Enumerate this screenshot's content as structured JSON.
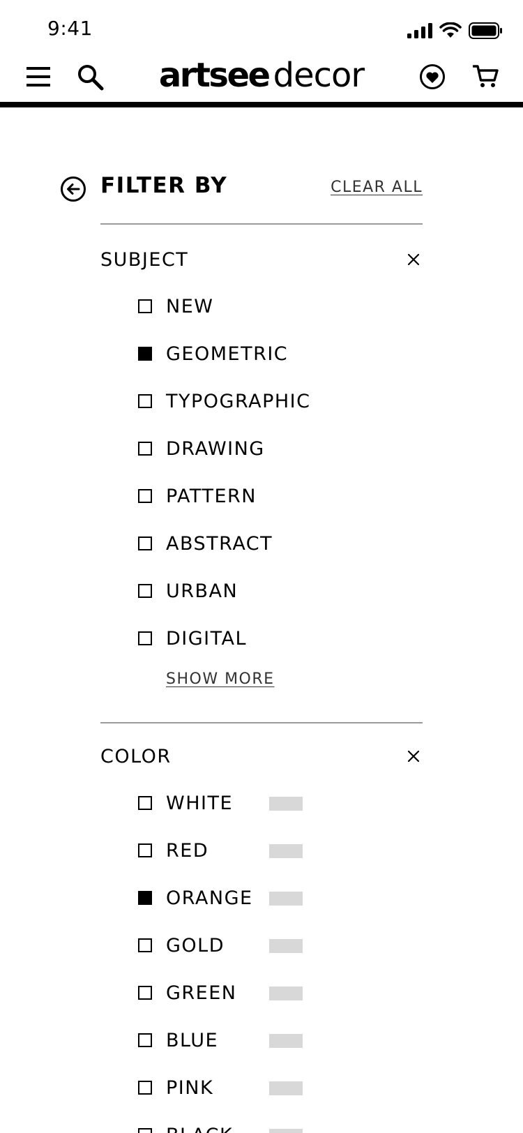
{
  "status_bar": {
    "time": "9:41"
  },
  "header": {
    "logo_bold": "artsee",
    "logo_light": "decor",
    "icons": [
      "menu-icon",
      "search-icon",
      "favorites-heart-icon",
      "cart-icon"
    ]
  },
  "filter": {
    "title": "FILTER BY",
    "clear_all": "CLEAR ALL"
  },
  "subject": {
    "title": "SUBJECT",
    "options": [
      {
        "label": "NEW",
        "checked": false
      },
      {
        "label": "GEOMETRIC",
        "checked": true
      },
      {
        "label": "TYPOGRAPHIC",
        "checked": false
      },
      {
        "label": "DRAWING",
        "checked": false
      },
      {
        "label": "PATTERN",
        "checked": false
      },
      {
        "label": "ABSTRACT",
        "checked": false
      },
      {
        "label": "URBAN",
        "checked": false
      },
      {
        "label": "DIGITAL",
        "checked": false
      }
    ],
    "show_more": "SHOW MORE"
  },
  "color": {
    "title": "COLOR",
    "swatch_color": "#d8d8d8",
    "options": [
      {
        "label": "WHITE",
        "checked": false
      },
      {
        "label": "RED",
        "checked": false
      },
      {
        "label": "ORANGE",
        "checked": true
      },
      {
        "label": "GOLD",
        "checked": false
      },
      {
        "label": "GREEN",
        "checked": false
      },
      {
        "label": "BLUE",
        "checked": false
      },
      {
        "label": "PINK",
        "checked": false
      },
      {
        "label": "BLACK",
        "checked": false
      }
    ]
  }
}
